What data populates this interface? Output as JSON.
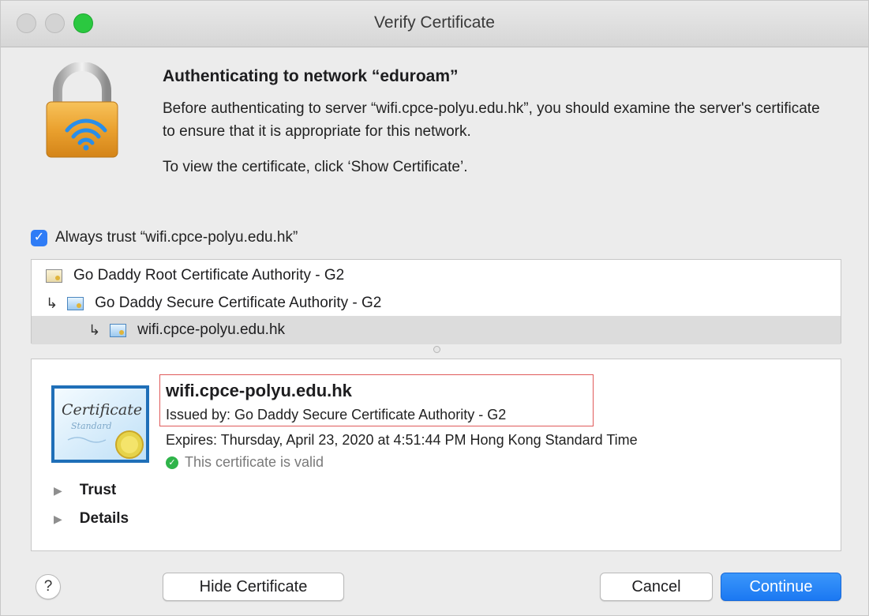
{
  "window": {
    "title": "Verify Certificate"
  },
  "header": {
    "heading": "Authenticating to network “eduroam”",
    "body": "Before authenticating to server “wifi.cpce-polyu.edu.hk”, you should examine the server's certificate to ensure that it is appropriate for this network.",
    "hint": "To view the certificate, click ‘Show Certificate’."
  },
  "trust_checkbox": {
    "checked": true,
    "label": "Always trust “wifi.cpce-polyu.edu.hk”"
  },
  "chain": {
    "items": [
      {
        "label": "Go Daddy Root Certificate Authority - G2",
        "icon": "certificate-icon"
      },
      {
        "label": "Go Daddy Secure Certificate Authority - G2",
        "icon": "certificate-icon"
      },
      {
        "label": "wifi.cpce-polyu.edu.hk",
        "icon": "certificate-icon",
        "selected": true
      }
    ]
  },
  "certificate": {
    "badge_text_1": "Certificate",
    "badge_text_2": "Standard",
    "name": "wifi.cpce-polyu.edu.hk",
    "issued_by": "Issued by: Go Daddy Secure Certificate Authority - G2",
    "expires": "Expires: Thursday, April 23, 2020 at 4:51:44 PM Hong Kong Standard Time",
    "status": "This certificate is valid",
    "status_color": "#2fb44a"
  },
  "sections": {
    "trust": "Trust",
    "details": "Details"
  },
  "buttons": {
    "help": "?",
    "hide_certificate": "Hide Certificate",
    "cancel": "Cancel",
    "continue": "Continue"
  },
  "colors": {
    "accent": "#1b78f2",
    "highlight_border": "#e05a5a",
    "zoom_button": "#2bc840"
  }
}
